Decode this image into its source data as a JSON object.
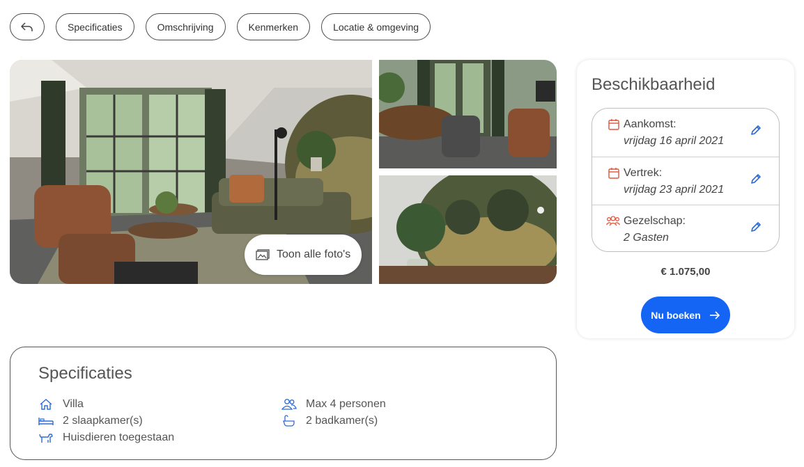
{
  "nav": {
    "back_icon": "reply-arrow-icon",
    "items": [
      "Specificaties",
      "Omschrijving",
      "Kenmerken",
      "Locatie & omgeving"
    ]
  },
  "gallery": {
    "show_all_label": "Toon alle foto's",
    "show_all_icon": "images-icon"
  },
  "availability": {
    "title": "Beschikbaarheid",
    "arrival": {
      "label": "Aankomst:",
      "value": "vrijdag 16 april 2021",
      "icon": "calendar-icon"
    },
    "departure": {
      "label": "Vertrek:",
      "value": "vrijdag 23 april 2021",
      "icon": "calendar-icon"
    },
    "guests": {
      "label": "Gezelschap:",
      "value": "2 Gasten",
      "icon": "people-group-icon"
    },
    "edit_icon": "pencil-icon",
    "price": "€ 1.075,00",
    "book_label": "Nu boeken",
    "book_icon": "arrow-right-icon"
  },
  "specs": {
    "title": "Specificaties",
    "items": [
      {
        "label": "Villa",
        "icon": "house-icon"
      },
      {
        "label": "2 slaapkamer(s)",
        "icon": "bed-icon"
      },
      {
        "label": "Huisdieren toegestaan",
        "icon": "dog-icon"
      },
      {
        "label": "Max 4 personen",
        "icon": "users-icon"
      },
      {
        "label": "2 badkamer(s)",
        "icon": "bathtub-icon"
      }
    ]
  },
  "colors": {
    "accent": "#1565f5",
    "icon_blue": "#2a6bd8",
    "icon_orange": "#e2533a"
  }
}
